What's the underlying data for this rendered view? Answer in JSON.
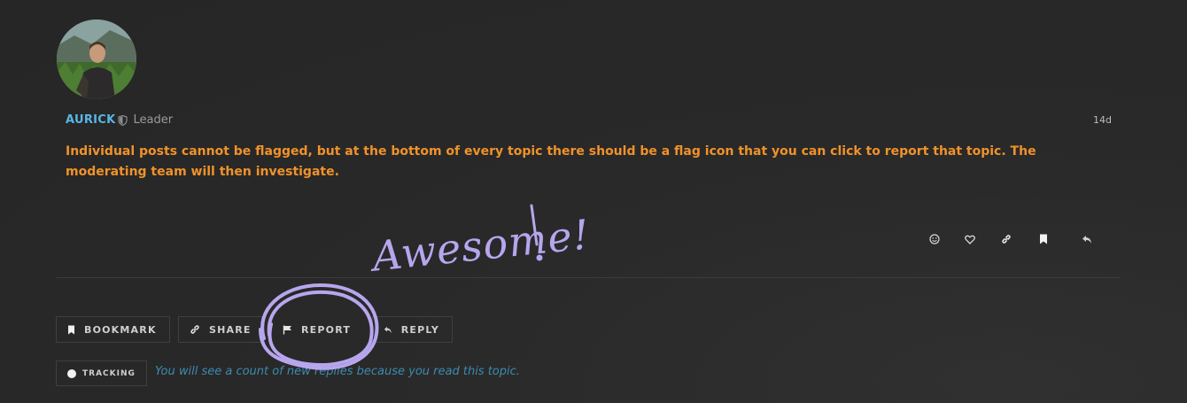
{
  "post": {
    "username": "AURICK",
    "user_title": "Leader",
    "date": "14d",
    "text": "Individual posts cannot be flagged, but at the bottom of every topic there should be a flag icon that you can click to report that topic. The moderating team will then investigate."
  },
  "post_actions": [
    "smile-icon",
    "heart-icon",
    "link-icon",
    "bookmark-icon",
    "reply-icon"
  ],
  "topic_footer": {
    "bookmark_label": "BOOKMARK",
    "share_label": "SHARE",
    "report_label": "REPORT",
    "reply_label": "REPLY",
    "tracking_label": "TRACKING",
    "tracking_text": "You will see a count of new replies because you read this topic."
  },
  "annotation": {
    "text": "Awesome!",
    "color": "#b7a6ee"
  },
  "colors": {
    "username": "#57b6e4",
    "post_text": "#f0922a",
    "tracking_text": "#3c8bb0"
  }
}
